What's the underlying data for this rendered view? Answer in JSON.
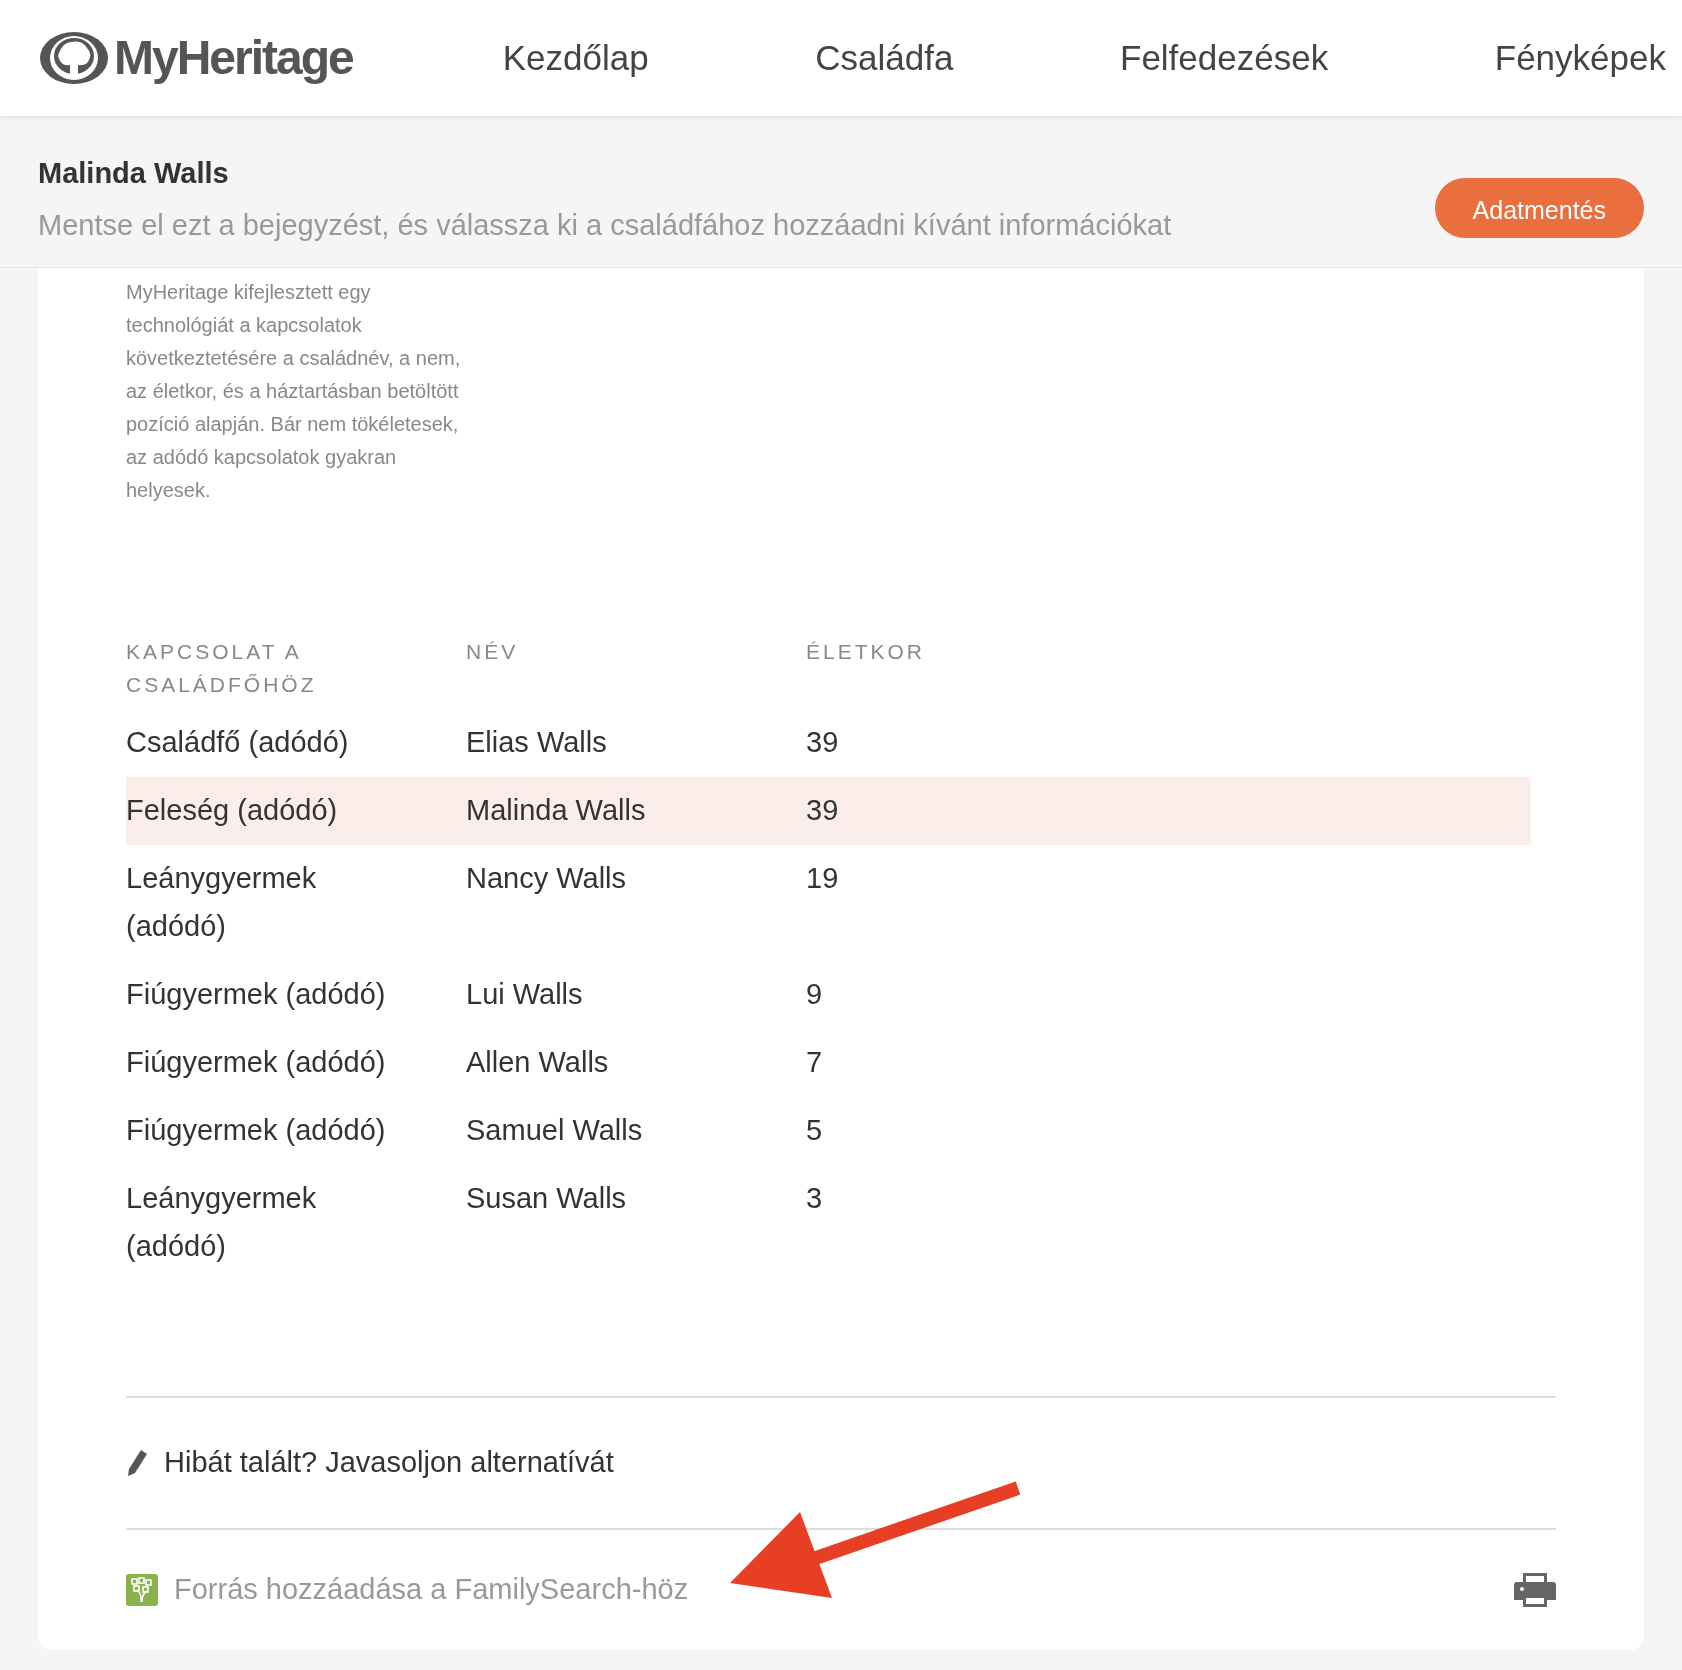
{
  "logo": {
    "text": "MyHeritage"
  },
  "nav": [
    {
      "label": "Kezdőlap"
    },
    {
      "label": "Családfa"
    },
    {
      "label": "Felfedezések"
    },
    {
      "label": "Fényképek"
    }
  ],
  "header": {
    "title": "Malinda Walls",
    "subtitle": "Mentse el ezt a bejegyzést, és válassza ki a családfához hozzáadni kívánt információkat",
    "button": "Adatmentés"
  },
  "note": "MyHeritage kifejlesztett egy technológiát a kapcsolatok következtetésére a családnév, a nem, az életkor, és a háztartásban betöltött pozíció alapján. Bár nem tökéletesek, az adódó kapcsolatok gyakran helyesek.",
  "table": {
    "columns": [
      "KAPCSOLAT A CSALÁDFŐHÖZ",
      "NÉV",
      "ÉLETKOR"
    ],
    "rows": [
      {
        "cells": [
          "Családfő (adódó)",
          "Elias Walls",
          "39"
        ],
        "selected": false
      },
      {
        "cells": [
          "Feleség (adódó)",
          "Malinda Walls",
          "39"
        ],
        "selected": true
      },
      {
        "cells": [
          "Leánygyermek (adódó)",
          "Nancy Walls",
          "19"
        ],
        "selected": false
      },
      {
        "cells": [
          "Fiúgyermek (adódó)",
          "Lui Walls",
          "9"
        ],
        "selected": false
      },
      {
        "cells": [
          "Fiúgyermek (adódó)",
          "Allen Walls",
          "7"
        ],
        "selected": false
      },
      {
        "cells": [
          "Fiúgyermek (adódó)",
          "Samuel Walls",
          "5"
        ],
        "selected": false
      },
      {
        "cells": [
          "Leánygyermek (adódó)",
          "Susan Walls",
          "3"
        ],
        "selected": false
      }
    ]
  },
  "suggest_link": "Hibát talált? Javasoljon alternatívát",
  "familysearch_link": "Forrás hozzáadása a FamilySearch-höz"
}
